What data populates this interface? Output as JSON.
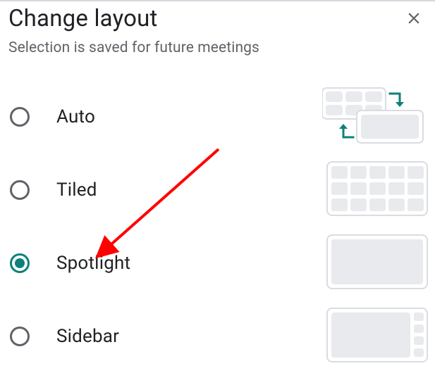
{
  "dialog": {
    "title": "Change layout",
    "subtitle": "Selection is saved for future meetings",
    "options": [
      {
        "label": "Auto",
        "selected": false
      },
      {
        "label": "Tiled",
        "selected": false
      },
      {
        "label": "Spotlight",
        "selected": true
      },
      {
        "label": "Sidebar",
        "selected": false
      }
    ]
  },
  "colors": {
    "accent": "#0b8179",
    "text": "#202124",
    "secondary": "#5f6368",
    "tile": "#e8eaed",
    "border": "#dadce0"
  },
  "annotation": {
    "type": "arrow",
    "color": "#ff0000"
  }
}
